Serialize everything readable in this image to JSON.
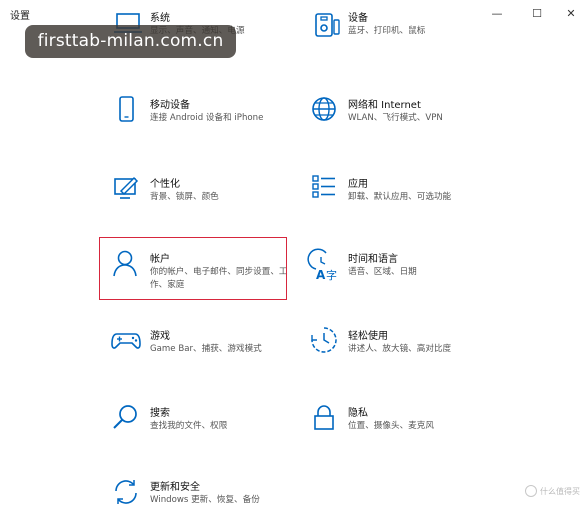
{
  "window": {
    "title": "设置",
    "minimize_glyph": "—",
    "maximize_glyph": "☐",
    "close_glyph": "✕"
  },
  "watermark": "firsttab-milan.com.cn",
  "accent_color": "#0067c0",
  "highlight_color": "#d7263d",
  "tiles": [
    {
      "name": "系统",
      "desc": "显示、声音、通知、电源",
      "icon": "laptop-icon"
    },
    {
      "name": "设备",
      "desc": "蓝牙、打印机、鼠标",
      "icon": "devices-icon"
    },
    {
      "name": "移动设备",
      "desc": "连接 Android 设备和 iPhone",
      "icon": "phone-icon"
    },
    {
      "name": "网络和 Internet",
      "desc": "WLAN、飞行模式、VPN",
      "icon": "globe-icon"
    },
    {
      "name": "个性化",
      "desc": "背景、锁屏、颜色",
      "icon": "personalization-icon"
    },
    {
      "name": "应用",
      "desc": "卸载、默认应用、可选功能",
      "icon": "apps-list-icon"
    },
    {
      "name": "帐户",
      "desc": "你的帐户、电子邮件、同步设置、工作、家庭",
      "icon": "person-icon",
      "selected": true
    },
    {
      "name": "时间和语言",
      "desc": "语音、区域、日期",
      "icon": "time-language-icon"
    },
    {
      "name": "游戏",
      "desc": "Game Bar、捕获、游戏模式",
      "icon": "gamepad-icon"
    },
    {
      "name": "轻松使用",
      "desc": "讲述人、放大镜、高对比度",
      "icon": "ease-of-access-icon"
    },
    {
      "name": "搜索",
      "desc": "查找我的文件、权限",
      "icon": "search-icon"
    },
    {
      "name": "隐私",
      "desc": "位置、摄像头、麦克风",
      "icon": "lock-icon"
    },
    {
      "name": "更新和安全",
      "desc": "Windows 更新、恢复、备份",
      "icon": "update-icon"
    }
  ],
  "corner_mark": "什么值得买"
}
